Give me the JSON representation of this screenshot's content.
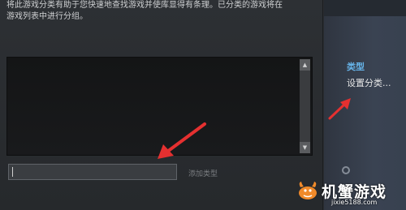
{
  "dialog": {
    "description_line1": "将此游戏分类有助于您快速地查找游戏并使库显得有条理。已分类的游戏将在",
    "description_line2": "游戏列表中进行分组。",
    "category_input": {
      "value": "",
      "placeholder": ""
    },
    "add_category_label": "添加类型"
  },
  "right_panel": {
    "type_label": "类型",
    "set_category_label": "设置分类..."
  },
  "watermark": {
    "title": "机蟹游戏",
    "site": "jixie5188.com"
  },
  "colors": {
    "accent_blue": "#66b3e8",
    "arrow_red": "#e53030",
    "dialog_bg": "#2a2d31",
    "list_bg": "#161718"
  },
  "icons": {
    "scroll_up": "triangle-up-icon",
    "scroll_down": "triangle-down-icon",
    "watermark_logo": "crab-logo-icon"
  }
}
